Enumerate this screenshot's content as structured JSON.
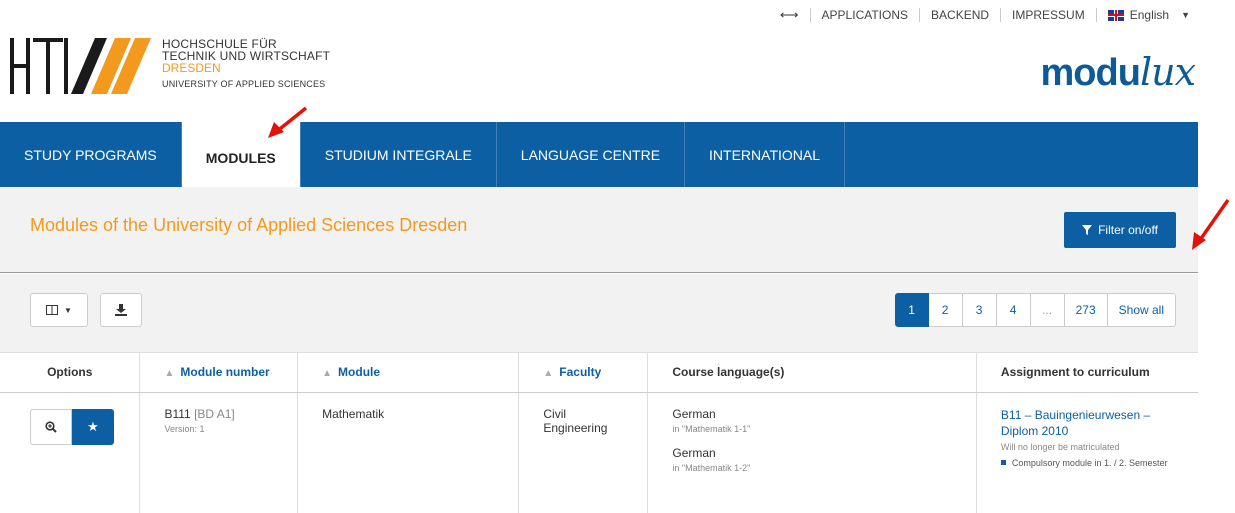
{
  "topbar": {
    "applications": "APPLICATIONS",
    "backend": "BACKEND",
    "impressum": "IMPRESSUM",
    "language": "English"
  },
  "header": {
    "institution_line1": "HOCHSCHULE FÜR",
    "institution_line2": "TECHNIK UND WIRTSCHAFT",
    "institution_line3": "DRESDEN",
    "institution_line4": "UNIVERSITY OF APPLIED SCIENCES",
    "product_prefix": "modu",
    "product_suffix": "lux"
  },
  "nav": {
    "items": [
      {
        "label": "STUDY PROGRAMS"
      },
      {
        "label": "MODULES"
      },
      {
        "label": "STUDIUM INTEGRALE"
      },
      {
        "label": "LANGUAGE CENTRE"
      },
      {
        "label": "INTERNATIONAL"
      }
    ],
    "active": "MODULES"
  },
  "main": {
    "title": "Modules of the University of Applied Sciences Dresden",
    "filter_label": "Filter on/off"
  },
  "pagination": {
    "pages": [
      "1",
      "2",
      "3",
      "4",
      "...",
      "273"
    ],
    "current": "1",
    "show_all": "Show all"
  },
  "table": {
    "headers": {
      "options": "Options",
      "module_number": "Module number",
      "module": "Module",
      "faculty": "Faculty",
      "course_languages": "Course language(s)",
      "assignment": "Assignment to curriculum"
    },
    "rows": [
      {
        "module_number": "B111",
        "module_alias": "[BD A1]",
        "version": "Version: 1",
        "module": "Mathematik",
        "faculty": "Civil Engineering",
        "languages": [
          {
            "language": "German",
            "context": "in \"Mathematik 1-1\""
          },
          {
            "language": "German",
            "context": "in \"Mathematik 1-2\""
          }
        ],
        "curriculum_link": "B11 – Bauingenieurwesen – Diplom 2010",
        "curriculum_note": "Will no longer be matriculated",
        "curriculum_detail": "Compulsory module in 1. / 2. Semester"
      }
    ]
  },
  "colors": {
    "brand_blue": "#0c5fa3",
    "accent_orange": "#f39a1e",
    "annotation_red": "#e3120b"
  }
}
